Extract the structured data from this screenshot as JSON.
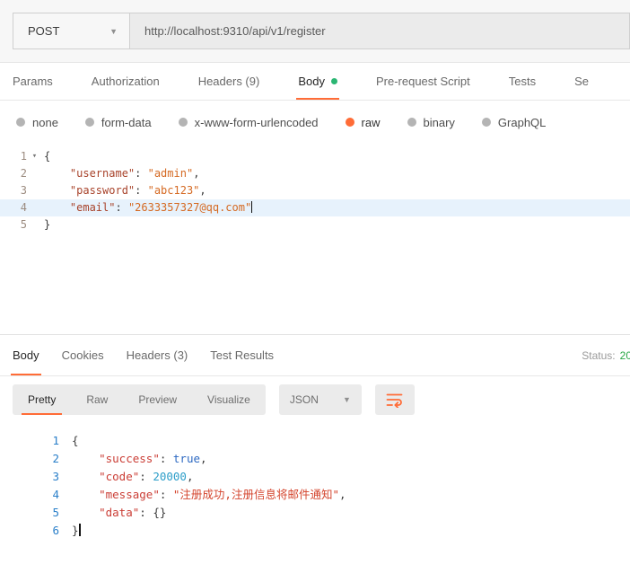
{
  "colors": {
    "accent": "#ff6c37",
    "status_ok": "#28a745",
    "body_indicator": "#2bb673",
    "line_highlight": "#e7f2fc"
  },
  "request": {
    "method": "POST",
    "url": "http://localhost:9310/api/v1/register",
    "tabs": [
      "Params",
      "Authorization",
      "Headers (9)",
      "Body",
      "Pre-request Script",
      "Tests",
      "Se"
    ],
    "body_types": [
      "none",
      "form-data",
      "x-www-form-urlencoded",
      "raw",
      "binary",
      "GraphQL"
    ],
    "editor": {
      "lines": [
        {
          "num": "1",
          "fold": true,
          "tokens": [
            {
              "t": "{",
              "c": "p"
            }
          ]
        },
        {
          "num": "2",
          "tokens": [
            {
              "t": "    ",
              "c": "ws"
            },
            {
              "t": "\"username\"",
              "c": "key"
            },
            {
              "t": ": ",
              "c": "p"
            },
            {
              "t": "\"admin\"",
              "c": "str"
            },
            {
              "t": ",",
              "c": "p"
            }
          ]
        },
        {
          "num": "3",
          "tokens": [
            {
              "t": "    ",
              "c": "ws"
            },
            {
              "t": "\"password\"",
              "c": "key"
            },
            {
              "t": ": ",
              "c": "p"
            },
            {
              "t": "\"abc123\"",
              "c": "str"
            },
            {
              "t": ",",
              "c": "p"
            }
          ]
        },
        {
          "num": "4",
          "highlight": true,
          "cursor": true,
          "tokens": [
            {
              "t": "    ",
              "c": "ws"
            },
            {
              "t": "\"email\"",
              "c": "key"
            },
            {
              "t": ": ",
              "c": "p"
            },
            {
              "t": "\"2633357327@qq.com\"",
              "c": "str"
            }
          ]
        },
        {
          "num": "5",
          "tokens": [
            {
              "t": "}",
              "c": "p"
            }
          ]
        }
      ]
    }
  },
  "response": {
    "tabs": [
      "Body",
      "Cookies",
      "Headers (3)",
      "Test Results"
    ],
    "status_label": "Status:",
    "status_value": "20",
    "view_tabs": [
      "Pretty",
      "Raw",
      "Preview",
      "Visualize"
    ],
    "format": "JSON",
    "editor": {
      "lines": [
        {
          "num": "1",
          "tokens": [
            {
              "t": "{",
              "c": "p"
            }
          ]
        },
        {
          "num": "2",
          "tokens": [
            {
              "t": "    ",
              "c": "ws"
            },
            {
              "t": "\"success\"",
              "c": "key"
            },
            {
              "t": ": ",
              "c": "p"
            },
            {
              "t": "true",
              "c": "bool"
            },
            {
              "t": ",",
              "c": "p"
            }
          ]
        },
        {
          "num": "3",
          "tokens": [
            {
              "t": "    ",
              "c": "ws"
            },
            {
              "t": "\"code\"",
              "c": "key"
            },
            {
              "t": ": ",
              "c": "p"
            },
            {
              "t": "20000",
              "c": "num"
            },
            {
              "t": ",",
              "c": "p"
            }
          ]
        },
        {
          "num": "4",
          "tokens": [
            {
              "t": "    ",
              "c": "ws"
            },
            {
              "t": "\"message\"",
              "c": "key"
            },
            {
              "t": ": ",
              "c": "p"
            },
            {
              "t": "\"注册成功,注册信息将邮件通知\"",
              "c": "str"
            },
            {
              "t": ",",
              "c": "p"
            }
          ]
        },
        {
          "num": "5",
          "tokens": [
            {
              "t": "    ",
              "c": "ws"
            },
            {
              "t": "\"data\"",
              "c": "key"
            },
            {
              "t": ": ",
              "c": "p"
            },
            {
              "t": "{}",
              "c": "p"
            }
          ]
        },
        {
          "num": "6",
          "cursor": true,
          "tokens": [
            {
              "t": "}",
              "c": "p"
            }
          ]
        }
      ]
    }
  }
}
